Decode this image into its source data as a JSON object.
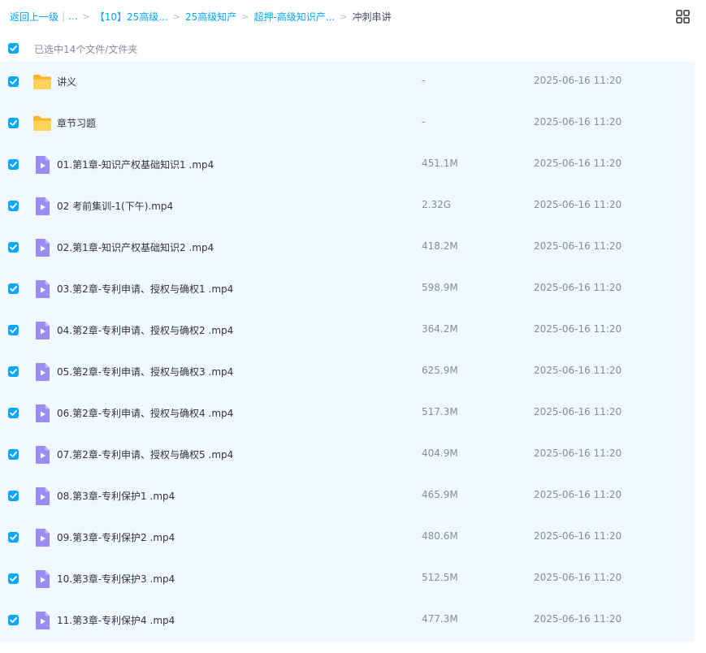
{
  "breadcrumb": {
    "back": "返回上一级",
    "more": "...",
    "items": [
      "【10】25高级...",
      "25高级知产",
      "超押-高级知识产..."
    ],
    "current": "冲刺串讲"
  },
  "toolbar": {
    "view_icon": "grid-view-icon"
  },
  "selection": {
    "text": "已选中14个文件/文件夹"
  },
  "colors": {
    "accent": "#06a7ff",
    "list_bg": "#f1f8ff",
    "folder": "#ffc83d",
    "video": "#9a8cf2"
  },
  "files": [
    {
      "name": "讲义",
      "size": "-",
      "time": "2025-06-16 11:20",
      "type": "folder"
    },
    {
      "name": "章节习题",
      "size": "-",
      "time": "2025-06-16 11:20",
      "type": "folder"
    },
    {
      "name": "01.第1章-知识产权基础知识1 .mp4",
      "size": "451.1M",
      "time": "2025-06-16 11:20",
      "type": "video"
    },
    {
      "name": "02 考前集训-1(下午).mp4",
      "size": "2.32G",
      "time": "2025-06-16 11:20",
      "type": "video"
    },
    {
      "name": "02.第1章-知识产权基础知识2 .mp4",
      "size": "418.2M",
      "time": "2025-06-16 11:20",
      "type": "video"
    },
    {
      "name": "03.第2章-专利申请、授权与确权1 .mp4",
      "size": "598.9M",
      "time": "2025-06-16 11:20",
      "type": "video"
    },
    {
      "name": "04.第2章-专利申请、授权与确权2 .mp4",
      "size": "364.2M",
      "time": "2025-06-16 11:20",
      "type": "video"
    },
    {
      "name": "05.第2章-专利申请、授权与确权3 .mp4",
      "size": "625.9M",
      "time": "2025-06-16 11:20",
      "type": "video"
    },
    {
      "name": "06.第2章-专利申请、授权与确权4 .mp4",
      "size": "517.3M",
      "time": "2025-06-16 11:20",
      "type": "video"
    },
    {
      "name": "07.第2章-专利申请、授权与确权5 .mp4",
      "size": "404.9M",
      "time": "2025-06-16 11:20",
      "type": "video"
    },
    {
      "name": "08.第3章-专利保护1 .mp4",
      "size": "465.9M",
      "time": "2025-06-16 11:20",
      "type": "video"
    },
    {
      "name": "09.第3章-专利保护2 .mp4",
      "size": "480.6M",
      "time": "2025-06-16 11:20",
      "type": "video"
    },
    {
      "name": "10.第3章-专利保护3 .mp4",
      "size": "512.5M",
      "time": "2025-06-16 11:20",
      "type": "video"
    },
    {
      "name": "11.第3章-专利保护4 .mp4",
      "size": "477.3M",
      "time": "2025-06-16 11:20",
      "type": "video"
    }
  ]
}
